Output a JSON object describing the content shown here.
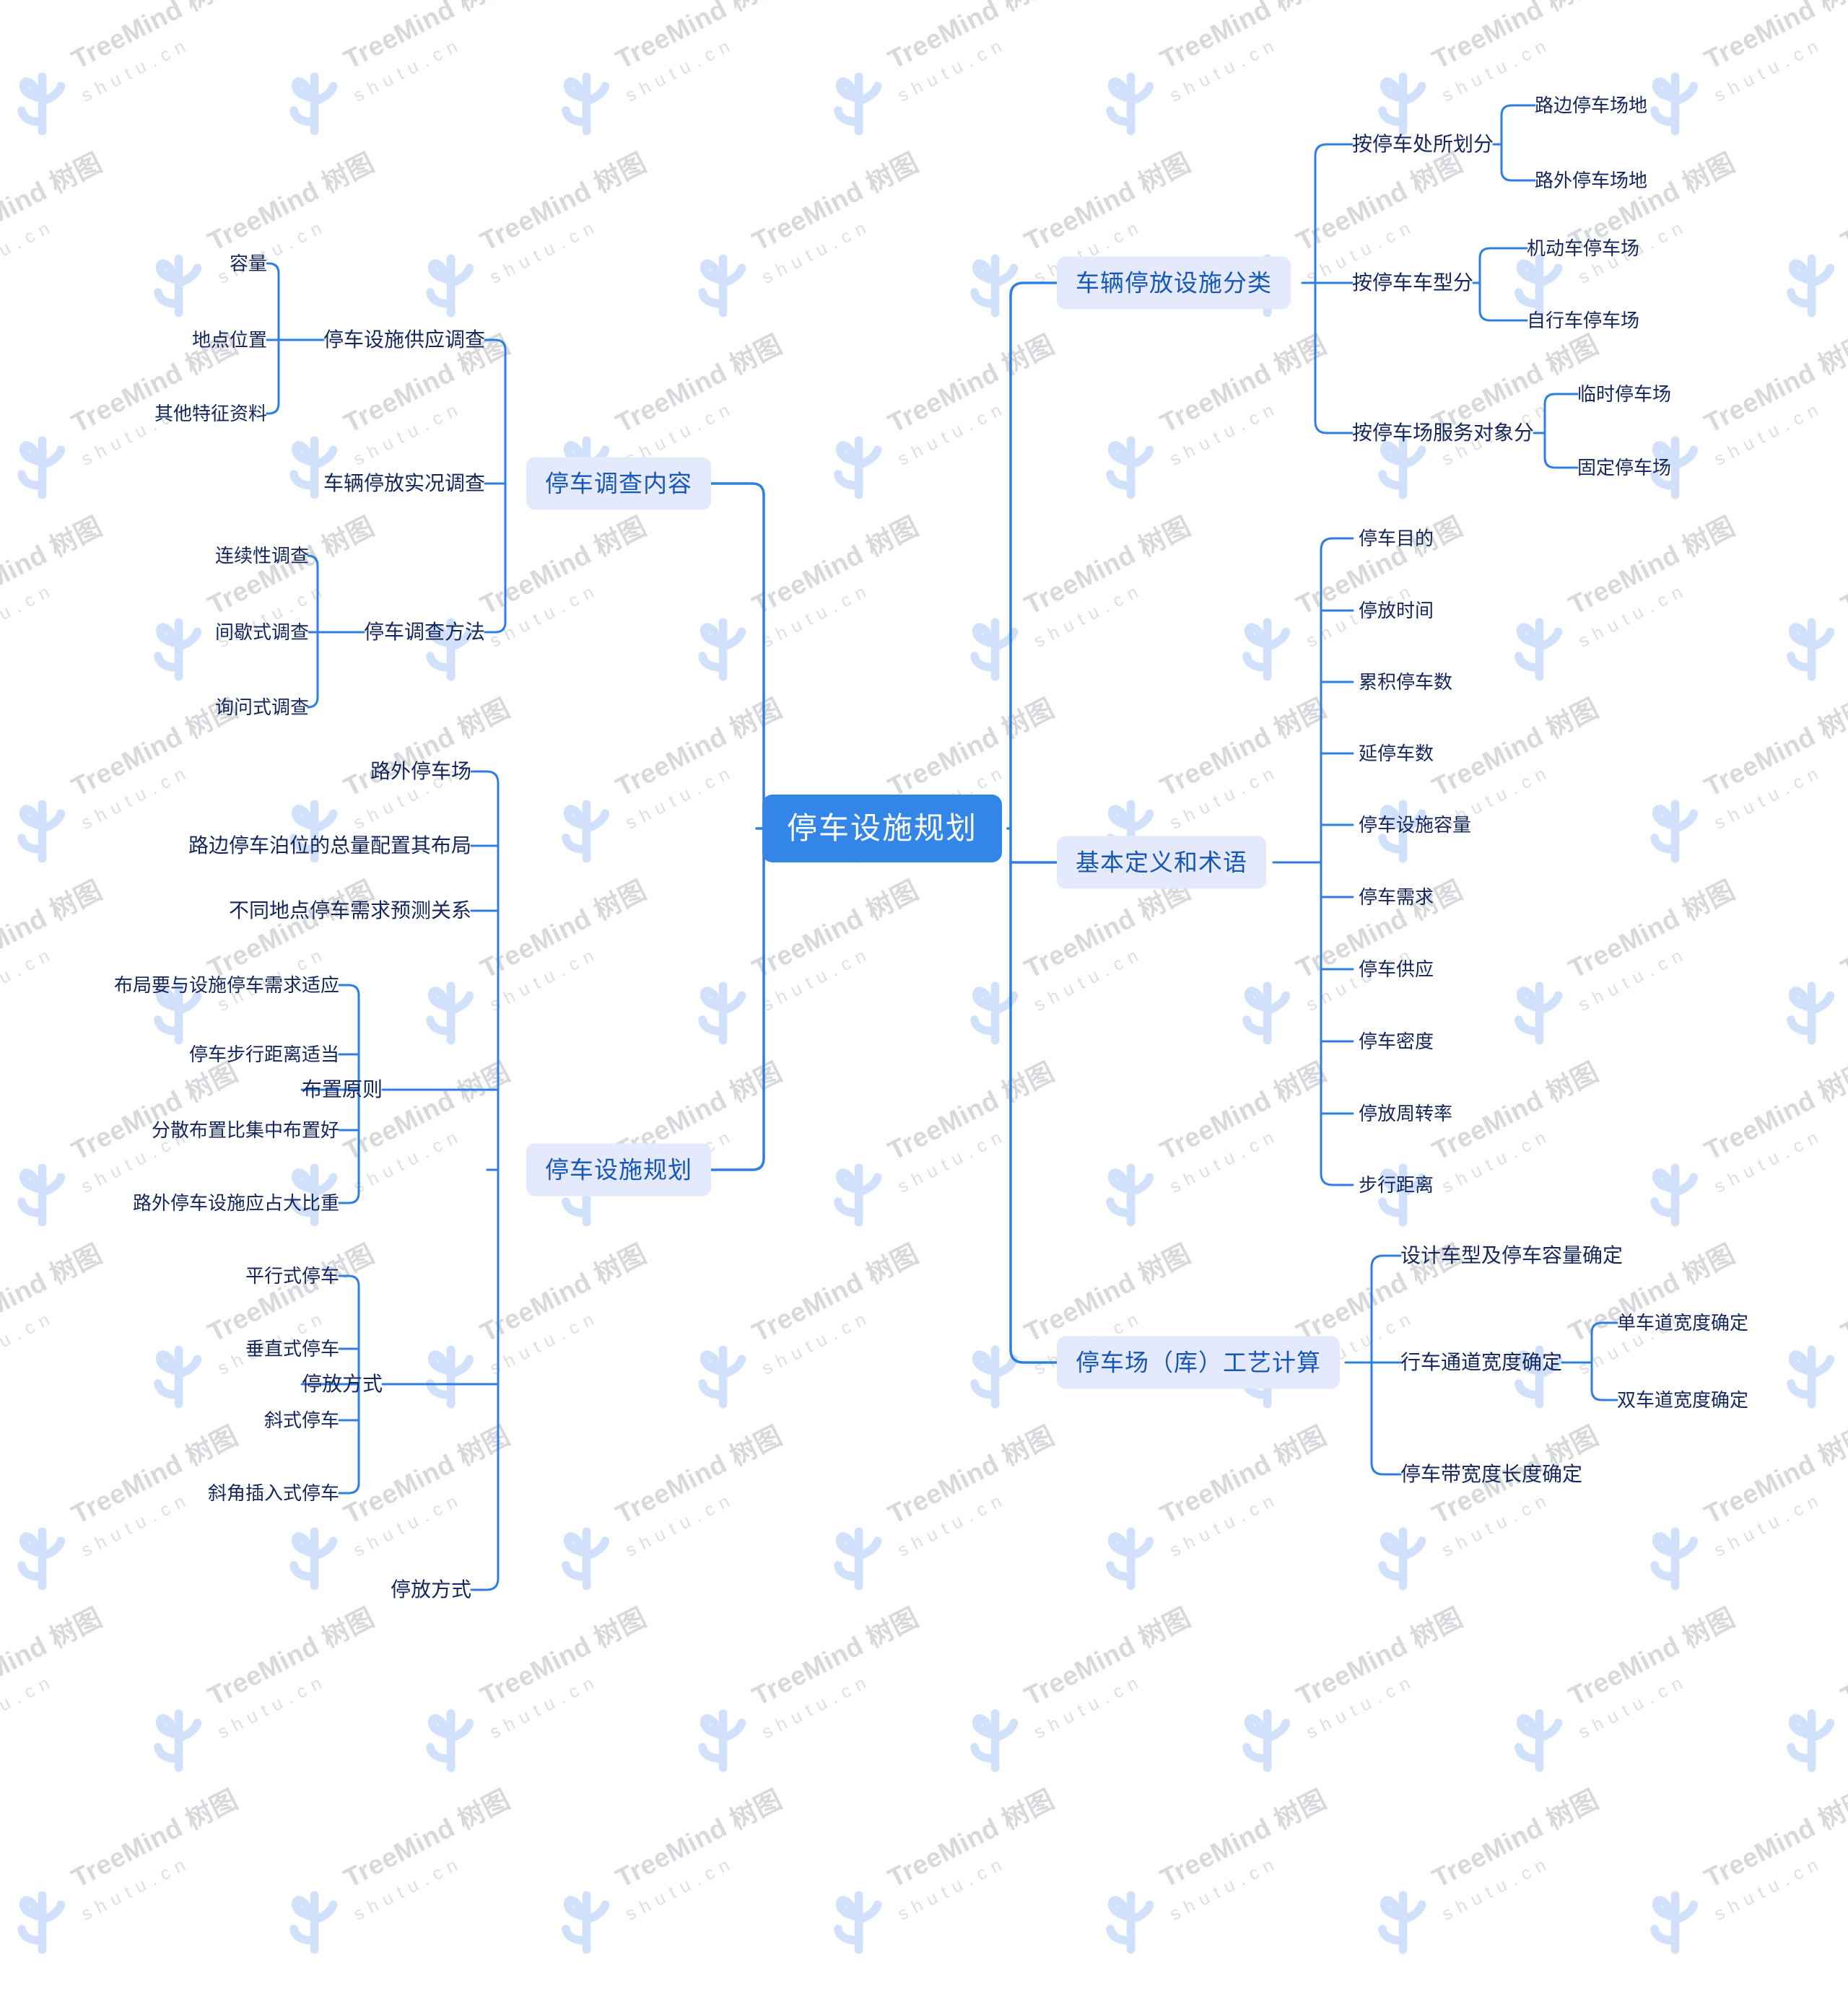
{
  "watermark": {
    "brand": "TreeMind 树图",
    "site": "shutu.cn",
    "logo_icon": "cactus-branch-icon"
  },
  "mindmap": {
    "root": {
      "label": "停车设施规划"
    },
    "left_branches": [
      {
        "label": "停车调查内容",
        "children": [
          {
            "label": "停车设施供应调查",
            "children": [
              {
                "label": "容量"
              },
              {
                "label": "地点位置"
              },
              {
                "label": "其他特征资料"
              }
            ]
          },
          {
            "label": "车辆停放实况调查",
            "children": []
          },
          {
            "label": "停车调查方法",
            "children": [
              {
                "label": "连续性调查"
              },
              {
                "label": "间歇式调查"
              },
              {
                "label": "询问式调查"
              }
            ]
          }
        ]
      },
      {
        "label": "停车设施规划",
        "children": [
          {
            "label": "路外停车场",
            "children": []
          },
          {
            "label": "路边停车泊位的总量配置其布局",
            "children": []
          },
          {
            "label": "不同地点停车需求预测关系",
            "children": []
          },
          {
            "label": "布置原则",
            "children": [
              {
                "label": "布局要与设施停车需求适应"
              },
              {
                "label": "停车步行距离适当"
              },
              {
                "label": "分散布置比集中布置好"
              },
              {
                "label": "路外停车设施应占大比重"
              }
            ]
          },
          {
            "label": "停放方式",
            "children": [
              {
                "label": "平行式停车"
              },
              {
                "label": "垂直式停车"
              },
              {
                "label": "斜式停车"
              },
              {
                "label": "斜角插入式停车"
              }
            ]
          },
          {
            "label": "停放方式",
            "children": []
          }
        ]
      }
    ],
    "right_branches": [
      {
        "label": "车辆停放设施分类",
        "children": [
          {
            "label": "按停车处所划分",
            "children": [
              {
                "label": "路边停车场地"
              },
              {
                "label": "路外停车场地"
              }
            ]
          },
          {
            "label": "按停车车型分",
            "children": [
              {
                "label": "机动车停车场"
              },
              {
                "label": "自行车停车场"
              }
            ]
          },
          {
            "label": "按停车场服务对象分",
            "children": [
              {
                "label": "临时停车场"
              },
              {
                "label": "固定停车场"
              }
            ]
          }
        ]
      },
      {
        "label": "基本定义和术语",
        "children": [
          {
            "label": "停车目的",
            "children": []
          },
          {
            "label": "停放时间",
            "children": []
          },
          {
            "label": "累积停车数",
            "children": []
          },
          {
            "label": "延停车数",
            "children": []
          },
          {
            "label": "停车设施容量",
            "children": []
          },
          {
            "label": "停车需求",
            "children": []
          },
          {
            "label": "停车供应",
            "children": []
          },
          {
            "label": "停车密度",
            "children": []
          },
          {
            "label": "停放周转率",
            "children": []
          },
          {
            "label": "步行距离",
            "children": []
          }
        ]
      },
      {
        "label": "停车场（库）工艺计算",
        "children": [
          {
            "label": "设计车型及停车容量确定",
            "children": []
          },
          {
            "label": "行车通道宽度确定",
            "children": [
              {
                "label": "单车道宽度确定"
              },
              {
                "label": "双车道宽度确定"
              }
            ]
          },
          {
            "label": "停车带宽度长度确定",
            "children": []
          }
        ]
      }
    ]
  },
  "colors": {
    "root_bg": "#3385e8",
    "root_text": "#ffffff",
    "level2_bg": "#e4eafb",
    "level2_text": "#1757b8",
    "leaf_text": "#14265c",
    "link": "#2e7fe0",
    "watermark_text": "#c9cbcf",
    "watermark_logo": "#cfe0fb",
    "canvas": "#ffffff"
  }
}
